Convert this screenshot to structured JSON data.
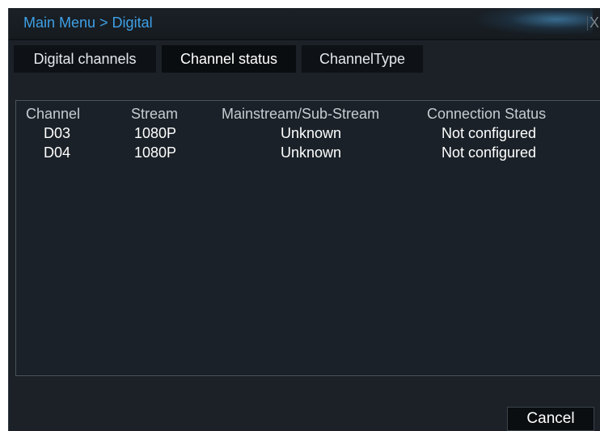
{
  "window": {
    "title": "Main Menu > Digital",
    "close_glyph": "X"
  },
  "tabs": [
    {
      "label": "Digital channels",
      "active": false
    },
    {
      "label": "Channel status",
      "active": true
    },
    {
      "label": "ChannelType",
      "active": false
    }
  ],
  "table": {
    "headers": [
      "Channel",
      "Stream",
      "Mainstream/Sub-Stream",
      "Connection Status"
    ],
    "rows": [
      {
        "channel": "D03",
        "stream": "1080P",
        "mainsub": "Unknown",
        "status": "Not configured"
      },
      {
        "channel": "D04",
        "stream": "1080P",
        "mainsub": "Unknown",
        "status": "Not configured"
      }
    ]
  },
  "buttons": {
    "cancel": "Cancel"
  },
  "colors": {
    "title_text": "#3ea0e6",
    "window_bg": "#1b2127",
    "tab_bg": "#0e1216"
  }
}
